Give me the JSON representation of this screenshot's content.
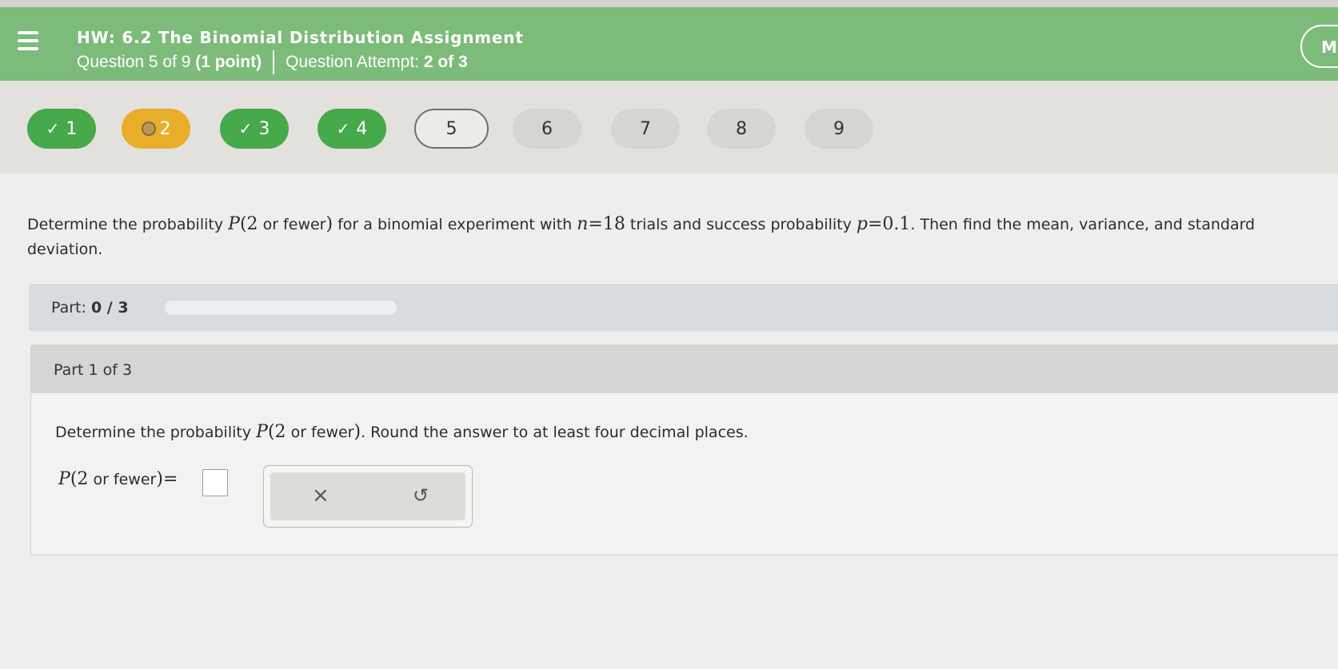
{
  "header": {
    "title": "HW: 6.2 The Binomial Distribution Assignment",
    "question_info_prefix": "Question 5 of 9 ",
    "question_points": "(1 point)",
    "attempt_prefix": "Question Attempt: ",
    "attempt_value": "2 of 3",
    "right_button_label": "Mi"
  },
  "questions": [
    {
      "label": "1",
      "status": "correct"
    },
    {
      "label": "2",
      "status": "partial"
    },
    {
      "label": "3",
      "status": "correct"
    },
    {
      "label": "4",
      "status": "correct"
    },
    {
      "label": "5",
      "status": "current"
    },
    {
      "label": "6",
      "status": "unanswered"
    },
    {
      "label": "7",
      "status": "unanswered"
    },
    {
      "label": "8",
      "status": "unanswered"
    },
    {
      "label": "9",
      "status": "unanswered"
    }
  ],
  "problem": {
    "t1": "Determine the probability ",
    "p_symbol": "P",
    "paren_open": "(",
    "p_arg_num": "2",
    "p_arg_text": " or fewer",
    "paren_close": ")",
    "t2": " for a binomial experiment with ",
    "n_symbol": "n",
    "eq": "=",
    "n_value": "18",
    "t3": " trials and success probability ",
    "p_var": "p",
    "eq2": "=",
    "p_value": "0.1",
    "t4": ". Then find the mean, variance, and standard deviation."
  },
  "parts": {
    "label": "Part: ",
    "progress_text": "0 / 3",
    "progress_fraction": 0
  },
  "part_card": {
    "header": "Part 1 of 3",
    "instruction_1": "Determine the probability ",
    "instruction_p": "P",
    "instruction_open": "(",
    "instruction_num": "2",
    "instruction_text": " or fewer",
    "instruction_close": ")",
    "instruction_2": ". Round the answer to at least four decimal places.",
    "eq_p": "P",
    "eq_open": "(",
    "eq_num": "2",
    "eq_text": " or fewer",
    "eq_close": ")",
    "eq_sign": "=",
    "answer_value": ""
  },
  "tools": {
    "clear_glyph": "×",
    "undo_glyph": "↺"
  },
  "colors": {
    "header_green": "#7dbb7a",
    "correct_green": "#46a94a",
    "partial_amber": "#e8ae2a"
  }
}
